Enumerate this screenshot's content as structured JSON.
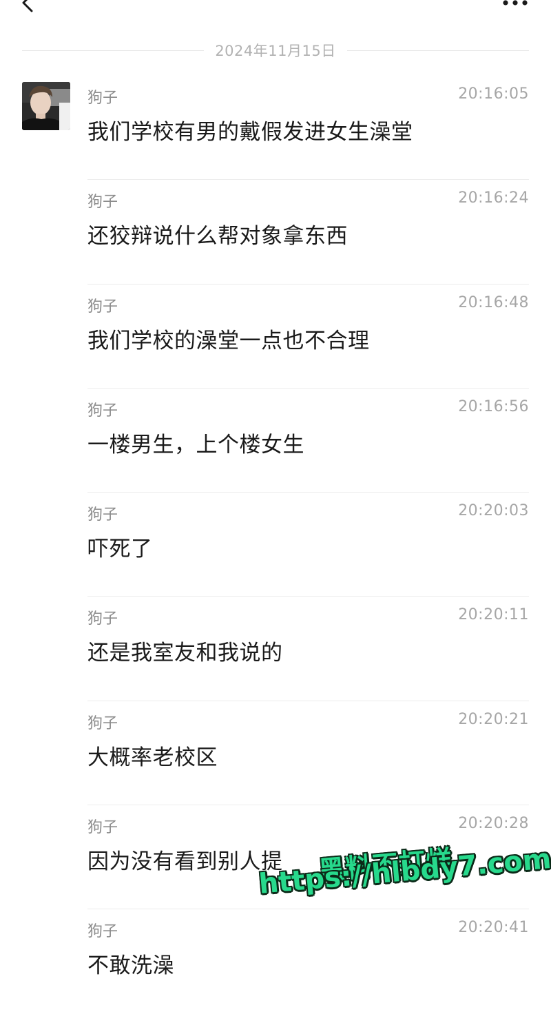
{
  "header": {
    "back_icon": "chevron-left-icon",
    "more_icon": "more-horizontal-icon"
  },
  "date_divider": "2024年11月15日",
  "avatar": {
    "icon": "user-avatar-photo"
  },
  "messages": [
    {
      "sender": "狗子",
      "time": "20:16:05",
      "text": "我们学校有男的戴假发进女生澡堂"
    },
    {
      "sender": "狗子",
      "time": "20:16:24",
      "text": "还狡辩说什么帮对象拿东西"
    },
    {
      "sender": "狗子",
      "time": "20:16:48",
      "text": "我们学校的澡堂一点也不合理"
    },
    {
      "sender": "狗子",
      "time": "20:16:56",
      "text": "一楼男生，上个楼女生"
    },
    {
      "sender": "狗子",
      "time": "20:20:03",
      "text": "吓死了"
    },
    {
      "sender": "狗子",
      "time": "20:20:11",
      "text": "还是我室友和我说的"
    },
    {
      "sender": "狗子",
      "time": "20:20:21",
      "text": "大概率老校区"
    },
    {
      "sender": "狗子",
      "time": "20:20:28",
      "text": "因为没有看到别人提"
    },
    {
      "sender": "狗子",
      "time": "20:20:41",
      "text": "不敢洗澡"
    }
  ],
  "watermark": {
    "line1": "黑料不打烊",
    "line2": "https://hlbdy7.com"
  }
}
